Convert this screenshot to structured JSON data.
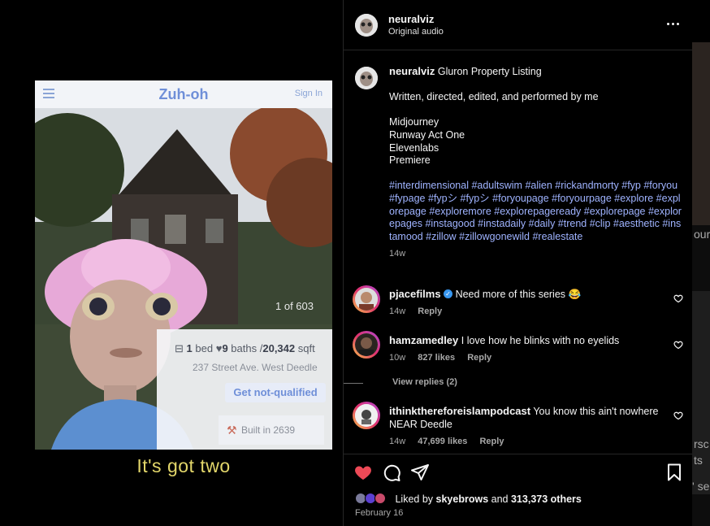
{
  "video": {
    "app_title": "Zuh-oh",
    "app_sign_in": "Sign In",
    "photo_counter": "1 of 603",
    "beds": "1",
    "beds_label": "bed",
    "baths": "9",
    "baths_label": "baths",
    "sqft": "20,342",
    "sqft_label": "sqft",
    "address": "237 Street Ave. West Deedle",
    "cta_label": "Get not-qualified",
    "built_label": "Built in 2639",
    "subtitle": "It's got two"
  },
  "post": {
    "username": "neuralviz",
    "audio": "Original audio"
  },
  "caption": {
    "username": "neuralviz",
    "title": "Gluron Property Listing",
    "credit": "Written, directed, edited, and performed by me",
    "tools": [
      "Midjourney",
      "Runway Act One",
      "Elevenlabs",
      "Premiere"
    ],
    "hashtags": "#interdimensional #adultswim #alien #rickandmorty #fyp #foryou #fypage #fypシ #fypシ  #foryoupage #foryourpage #explore #explorepage #exploremore #explorepageready #explorepage  #explorepages #instagood #instadaily #daily #trend #clip #aesthetic #instamood #zillow #zillowgonewild #realestate",
    "age": "14w"
  },
  "comments": [
    {
      "username": "pjacefilms",
      "verified": true,
      "text": "Need more of this series 😂",
      "age": "14w",
      "likes": "",
      "reply": "Reply"
    },
    {
      "username": "hamzamedley",
      "verified": false,
      "text": "I love how he blinks with no eyelids",
      "age": "10w",
      "likes": "827 likes",
      "reply": "Reply"
    },
    {
      "username": "ithinkthereforeislampodcast",
      "verified": false,
      "text": "You know this ain't nowhere NEAR Deedle",
      "age": "14w",
      "likes": "47,699 likes",
      "reply": "Reply"
    }
  ],
  "view_replies": "View replies (2)",
  "likes": {
    "prefix": "Liked by",
    "user": "skyebrows",
    "joiner": "and",
    "others": "313,373 others"
  },
  "date": "February 16",
  "peek_text": {
    "a": "our",
    "b": "rsc",
    "c": "ts",
    "d": "' se"
  },
  "colors": {
    "like_red": "#ed4956",
    "hashtag_blue": "#9fb3ff",
    "subtitle_yellow": "#e2d66a",
    "verified_blue": "#3897f0"
  },
  "icons": [
    "heart-icon",
    "comment-icon",
    "share-icon",
    "bookmark-icon",
    "more-icon",
    "verified-icon"
  ]
}
